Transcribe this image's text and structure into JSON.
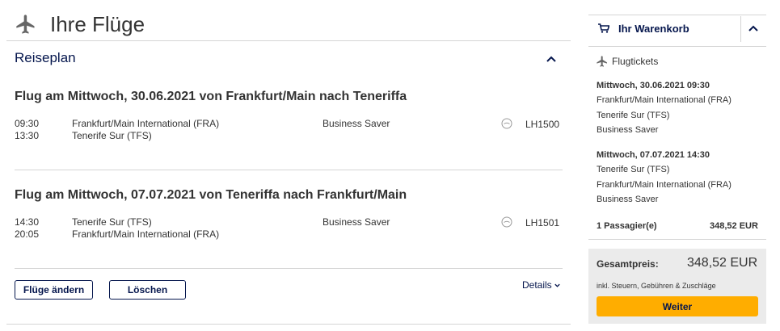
{
  "page": {
    "title": "Ihre Flüge",
    "section_title": "Reiseplan"
  },
  "flights": [
    {
      "heading": "Flug am Mittwoch, 30.06.2021 von Frankfurt/Main nach Teneriffa",
      "dep_time": "09:30",
      "arr_time": "13:30",
      "dep_airport": "Frankfurt/Main International (FRA)",
      "arr_airport": "Tenerife Sur (TFS)",
      "fare": "Business Saver",
      "flight_no": "LH1500"
    },
    {
      "heading": "Flug am Mittwoch, 07.07.2021 von Teneriffa nach Frankfurt/Main",
      "dep_time": "14:30",
      "arr_time": "20:05",
      "dep_airport": "Tenerife Sur (TFS)",
      "arr_airport": "Frankfurt/Main International (FRA)",
      "fare": "Business Saver",
      "flight_no": "LH1501"
    }
  ],
  "actions": {
    "change_label": "Flüge ändern",
    "delete_label": "Löschen",
    "details_label": "Details"
  },
  "cart": {
    "title": "Ihr Warenkorb",
    "section_label": "Flugtickets",
    "outbound": {
      "datetime": "Mittwoch, 30.06.2021 09:30",
      "from": "Frankfurt/Main International (FRA)",
      "to": "Tenerife Sur (TFS)",
      "fare": "Business Saver"
    },
    "inbound": {
      "datetime": "Mittwoch, 07.07.2021 14:30",
      "from": "Tenerife Sur (TFS)",
      "to": "Frankfurt/Main International (FRA)",
      "fare": "Business Saver"
    },
    "passengers": "1 Passagier(e)",
    "passenger_price": "348,52 EUR",
    "total_label": "Gesamtpreis:",
    "total_value": "348,52 EUR",
    "total_note": "inkl. Steuern, Gebühren & Zuschläge",
    "continue_label": "Weiter"
  },
  "colors": {
    "brand_navy": "#05164d",
    "accent_yellow": "#ffad00",
    "divider": "#d5d5d5",
    "total_bg": "#ebebeb"
  },
  "icons": {
    "title": "plane-icon",
    "collapse": "chevron-up-icon",
    "cart": "shopping-cart-icon",
    "airline": "lufthansa-crane-icon",
    "details": "chevron-down-icon"
  }
}
